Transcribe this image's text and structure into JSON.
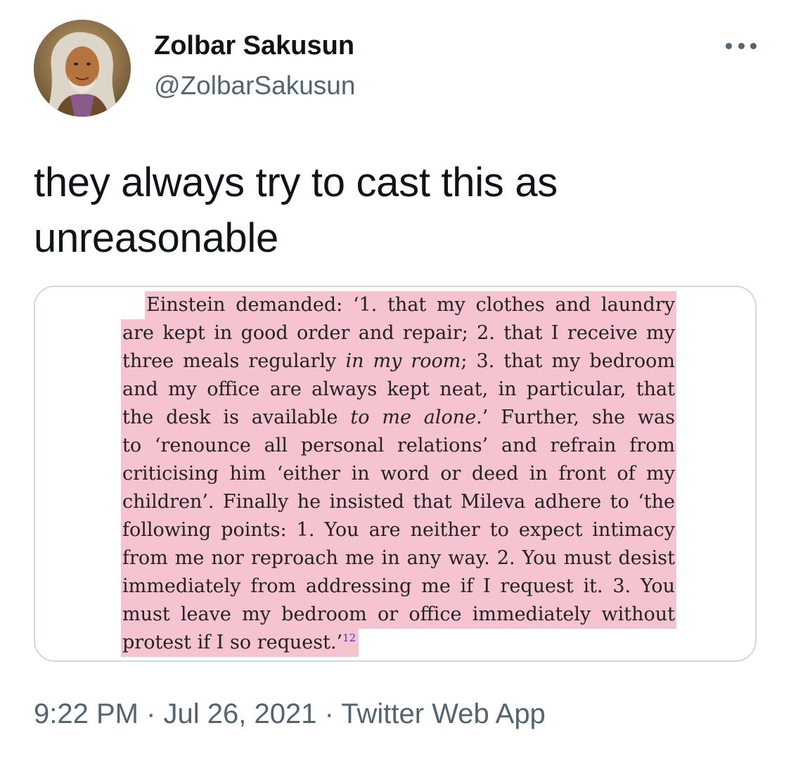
{
  "author": {
    "display_name": "Zolbar Sakusun",
    "handle": "@ZolbarSakusun",
    "avatar_icon": "profile-photo"
  },
  "tweet": {
    "text": "they always try to cast this as unreasonable"
  },
  "media": {
    "highlight_color": "#f6c3d0",
    "lines": [
      "Einstein demanded: ‘1. that my clothes and laundry",
      "are kept in good order and repair; 2. that I receive my",
      "three meals regularly",
      "in my room",
      "; 3. that my bedroom",
      "and my office are always kept neat, in particular, that",
      "the desk is available",
      "to me alone.",
      "’ Further, she was",
      "to ‘renounce all personal relations’ and refrain from",
      "criticising him ‘either in word or deed in front of my",
      "children’. Finally he insisted that Mileva adhere to ‘the",
      "following points: 1. You are neither to expect intimacy",
      "from me nor reproach me in any way. 2. You must desist",
      "immediately from addressing me if I request it. 3. You",
      "must leave my bedroom or office immediately without",
      "protest if I so request.’",
      "12"
    ]
  },
  "meta": {
    "time": "9:22 PM",
    "separator": " · ",
    "date": "Jul 26, 2021",
    "source": "Twitter Web App"
  },
  "colors": {
    "text_primary": "#0f1419",
    "text_secondary": "#536471",
    "card_border": "#cfd9de"
  }
}
